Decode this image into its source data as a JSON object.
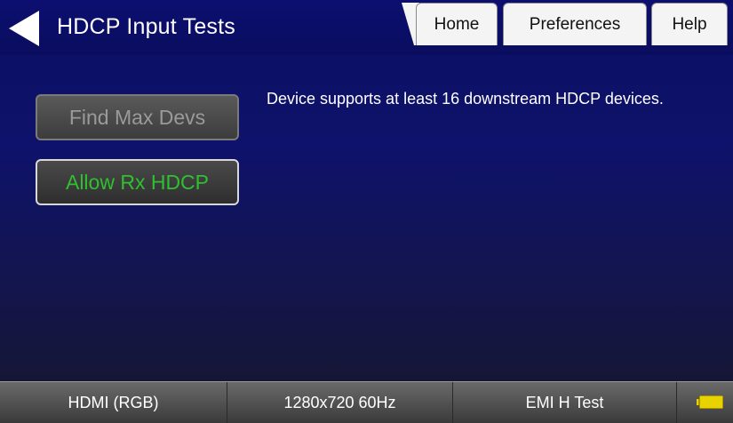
{
  "header": {
    "title": "HDCP Input Tests",
    "tabs": [
      "Home",
      "Preferences",
      "Help"
    ]
  },
  "buttons": {
    "find_max_devs": "Find Max Devs",
    "allow_rx_hdcp": "Allow Rx HDCP"
  },
  "message": "Device supports at least 16 downstream HDCP devices.",
  "statusbar": {
    "interface": "HDMI (RGB)",
    "resolution": "1280x720 60Hz",
    "format": "EMI H Test"
  },
  "colors": {
    "background": "#0e126a",
    "active_button_text": "#2fc02f",
    "battery": "#e8d200"
  },
  "icons": {
    "back": "back-arrow-icon",
    "battery": "battery-icon"
  }
}
